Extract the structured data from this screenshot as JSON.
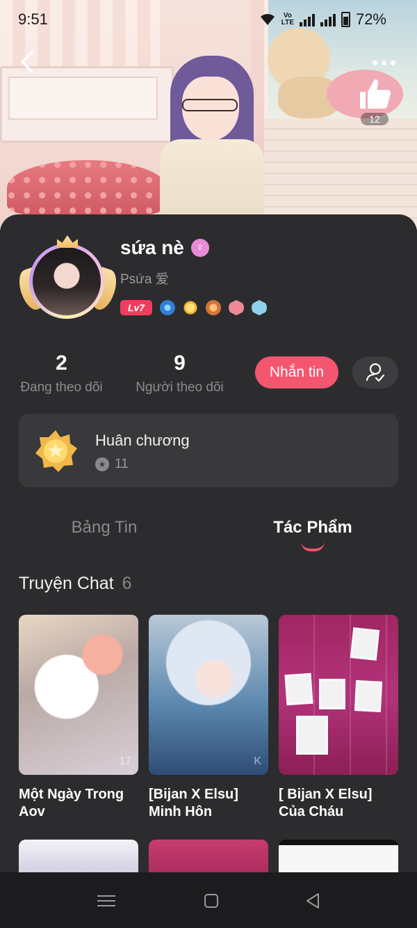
{
  "status_bar": {
    "time": "9:51",
    "network": "Vo LTE",
    "battery": "72%"
  },
  "header": {
    "back_icon": "chevron-left-icon",
    "more_icon": "more-dots-icon",
    "like_count": "12"
  },
  "profile": {
    "name": "sứa nè",
    "gender_icon": "female-icon",
    "handle": "Psứa 爱",
    "level": "Lv7"
  },
  "stats": {
    "following": {
      "count": "2",
      "label": "Đang theo dõi"
    },
    "followers": {
      "count": "9",
      "label": "Người theo dõi"
    }
  },
  "actions": {
    "message_label": "Nhắn tin",
    "follow_icon": "user-check-icon"
  },
  "medal": {
    "title": "Huân chương",
    "count": "11"
  },
  "tabs": [
    {
      "label": "Bảng Tin",
      "active": false
    },
    {
      "label": "Tác Phẩm",
      "active": true
    }
  ],
  "section": {
    "title": "Truyện Chat",
    "count": "6"
  },
  "stories": [
    {
      "title": "Một Ngày Trong Aov",
      "overlay": "17"
    },
    {
      "title": "[Bijan X Elsu] Minh Hôn",
      "overlay": "K"
    },
    {
      "title": "[ Bijan X Elsu] Của Cháu",
      "overlay": ""
    }
  ],
  "colors": {
    "accent": "#f4566f",
    "background": "#2c2c2e",
    "card": "#39393c"
  }
}
